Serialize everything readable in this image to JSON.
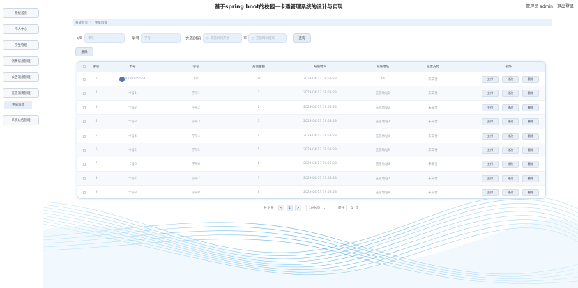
{
  "header": {
    "title": "基于spring boot的校园一卡通管理系统的设计与实现",
    "user_label": "管理员 admin",
    "logout_label": "退出登录"
  },
  "sidebar": {
    "items": [
      {
        "label": "系统首页"
      },
      {
        "label": "个人中心"
      },
      {
        "label": "学生管理"
      },
      {
        "label": "消费信息管理"
      },
      {
        "label": "公告消息管理"
      },
      {
        "label": "充值消费管理"
      },
      {
        "label": "充值消费"
      },
      {
        "label": "系统公告管理"
      }
    ]
  },
  "breadcrumb": {
    "home": "系统首页",
    "sep": ">",
    "current": "充值消费"
  },
  "search": {
    "card_label": "卡号",
    "card_placeholder": "卡号",
    "student_label": "学号",
    "student_placeholder": "学号",
    "time_label": "充值时间",
    "time_start_placeholder": "充值时间开始",
    "to_label": "至",
    "time_end_placeholder": "充值时间结束",
    "query_label": "查询"
  },
  "toolbar": {
    "delete_label": "删除"
  },
  "table": {
    "headers": [
      "索引",
      "卡号",
      "学号",
      "充值金额",
      "充值时间",
      "充值地址",
      "是否支付",
      "操作"
    ],
    "rows": [
      {
        "idx": "1",
        "card": "1681186959564",
        "sid": "111",
        "amount": "100",
        "time": "2023-04-13 19:53:23",
        "addr": "AA",
        "paid": "未支付"
      },
      {
        "idx": "2",
        "card": "卡号1",
        "sid": "学号1",
        "amount": "1",
        "time": "2023-04-13 19:53:23",
        "addr": "充值地址1",
        "paid": "未支付"
      },
      {
        "idx": "3",
        "card": "卡号2",
        "sid": "学号2",
        "amount": "2",
        "time": "2023-04-13 19:53:23",
        "addr": "充值地址2",
        "paid": "未支付"
      },
      {
        "idx": "4",
        "card": "卡号3",
        "sid": "学号3",
        "amount": "3",
        "time": "2023-04-13 19:53:23",
        "addr": "充值地址3",
        "paid": "未支付"
      },
      {
        "idx": "5",
        "card": "卡号4",
        "sid": "学号4",
        "amount": "4",
        "time": "2023-04-13 19:53:23",
        "addr": "充值地址4",
        "paid": "未支付"
      },
      {
        "idx": "6",
        "card": "卡号5",
        "sid": "学号5",
        "amount": "5",
        "time": "2023-04-13 19:53:23",
        "addr": "充值地址5",
        "paid": "未支付"
      },
      {
        "idx": "7",
        "card": "卡号6",
        "sid": "学号6",
        "amount": "6",
        "time": "2023-04-13 19:53:23",
        "addr": "充值地址6",
        "paid": "未支付"
      },
      {
        "idx": "8",
        "card": "卡号7",
        "sid": "学号7",
        "amount": "7",
        "time": "2023-04-13 19:53:23",
        "addr": "充值地址7",
        "paid": "未支付"
      },
      {
        "idx": "9",
        "card": "卡号8",
        "sid": "学号8",
        "amount": "8",
        "time": "2023-04-13 19:53:23",
        "addr": "充值地址8",
        "paid": "未支付"
      }
    ],
    "actions": {
      "pay": "支付",
      "edit": "修改",
      "delete": "删除"
    }
  },
  "pagination": {
    "total": "共 9 条",
    "prev": "<",
    "page": "1",
    "next": ">",
    "per_page": "10条/页",
    "goto": "前往",
    "goto_value": "1",
    "page_unit": "页"
  }
}
